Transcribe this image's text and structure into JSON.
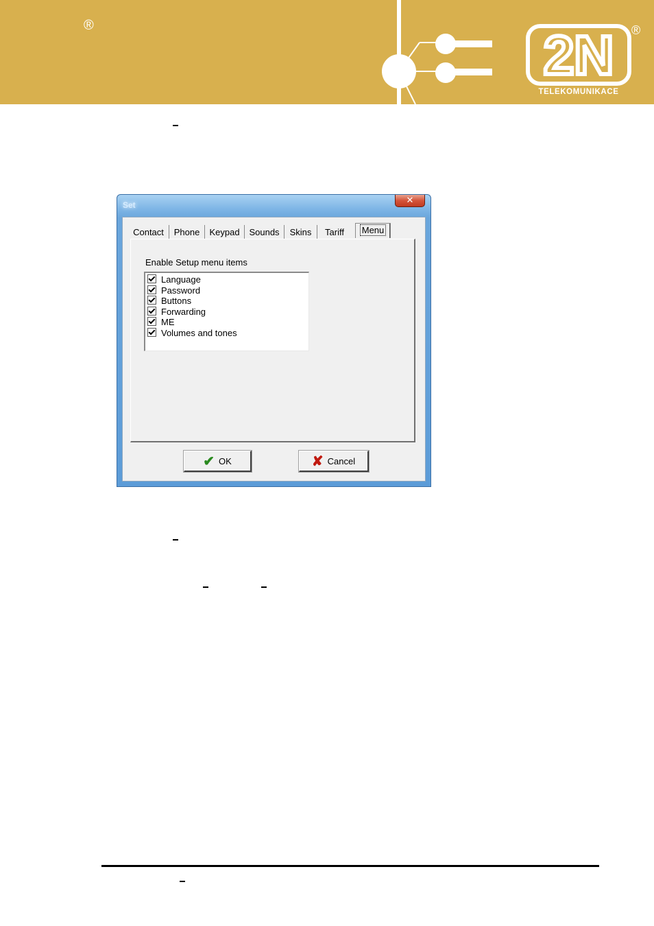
{
  "header": {
    "left_registered": "®",
    "logo_text": "2N",
    "logo_registered": "®",
    "logo_subtitle": "TELEKOMUNIKACE",
    "colors": {
      "banner": "#d8b04e",
      "logo": "#ffffff"
    }
  },
  "dialog": {
    "title": "Set",
    "close_glyph": "✕",
    "tabs": [
      {
        "label": "Contact",
        "active": false
      },
      {
        "label": "Phone",
        "active": false
      },
      {
        "label": "Keypad",
        "active": false
      },
      {
        "label": "Sounds",
        "active": false
      },
      {
        "label": "Skins",
        "active": false
      },
      {
        "label": "Tariff",
        "active": false
      },
      {
        "label": "Menu",
        "active": true
      }
    ],
    "group_label": "Enable Setup menu items",
    "items": [
      {
        "label": "Language",
        "checked": true
      },
      {
        "label": "Password",
        "checked": true
      },
      {
        "label": "Buttons",
        "checked": true
      },
      {
        "label": "Forwarding",
        "checked": true
      },
      {
        "label": "ME",
        "checked": true
      },
      {
        "label": "Volumes and tones",
        "checked": true
      }
    ],
    "ok_button": {
      "icon": "check-icon",
      "label": "OK"
    },
    "cancel_button": {
      "icon": "x-icon",
      "label": "Cancel"
    }
  }
}
